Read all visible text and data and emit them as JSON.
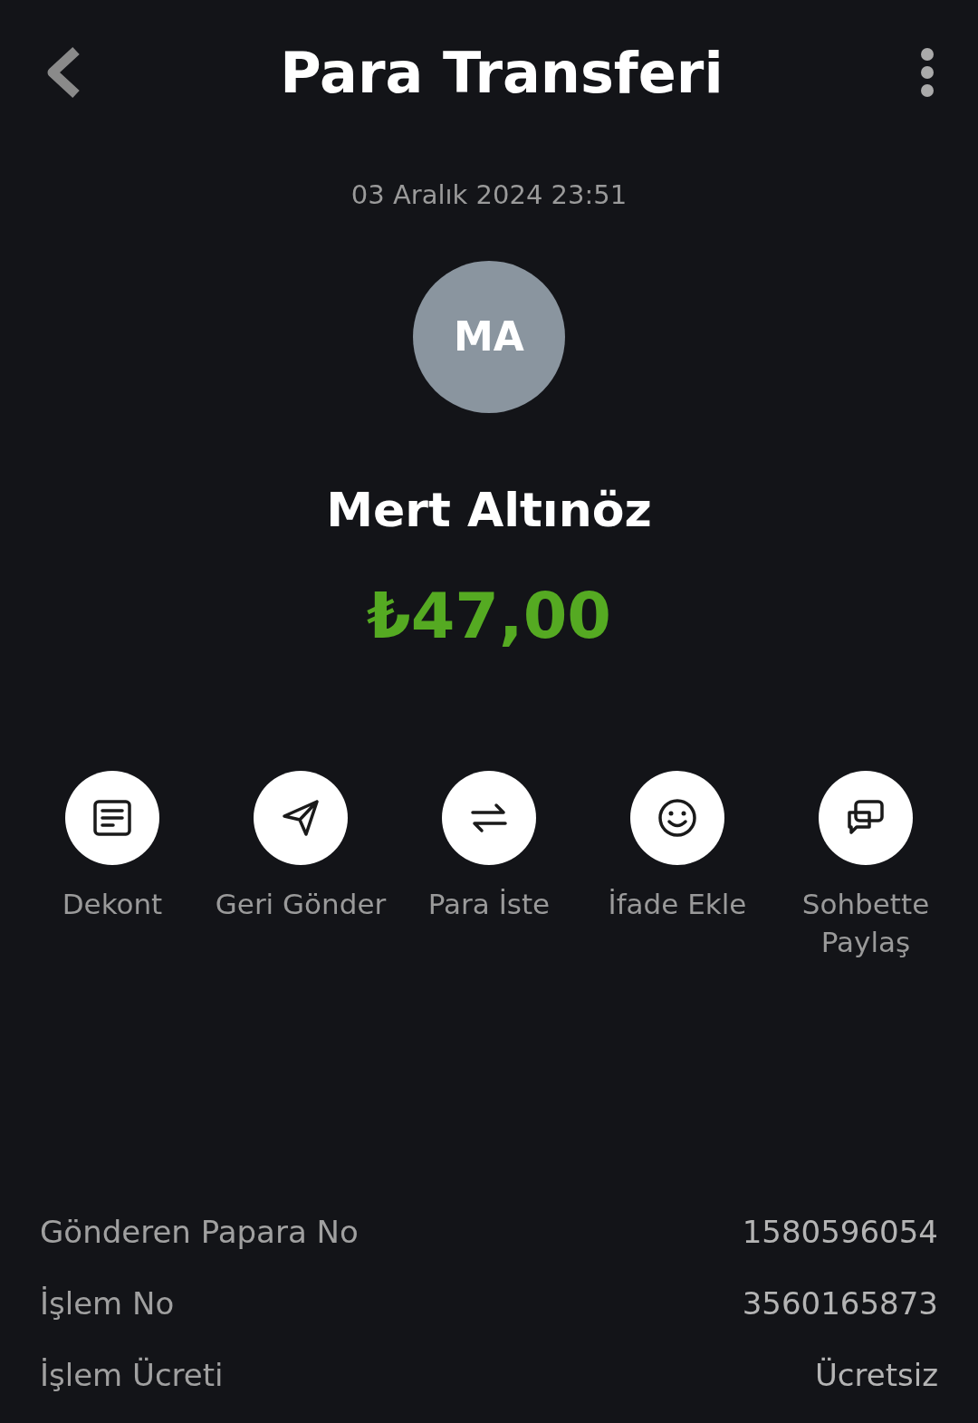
{
  "header": {
    "title": "Para Transferi"
  },
  "date": "03 Aralık 2024 23:51",
  "recipient": {
    "initials": "MA",
    "name": "Mert Altınöz"
  },
  "amount": "₺47,00",
  "actions": [
    {
      "kind": "receipt",
      "label": "Dekont"
    },
    {
      "kind": "send",
      "label": "Geri Gönder"
    },
    {
      "kind": "exchange",
      "label": "Para İste"
    },
    {
      "kind": "smile",
      "label": "İfade Ekle"
    },
    {
      "kind": "chat",
      "label": "Sohbette Paylaş"
    }
  ],
  "details": [
    {
      "label": "Gönderen Papara No",
      "value": "1580596054"
    },
    {
      "label": "İşlem No",
      "value": "3560165873"
    },
    {
      "label": "İşlem Ücreti",
      "value": "Ücretsiz"
    }
  ]
}
